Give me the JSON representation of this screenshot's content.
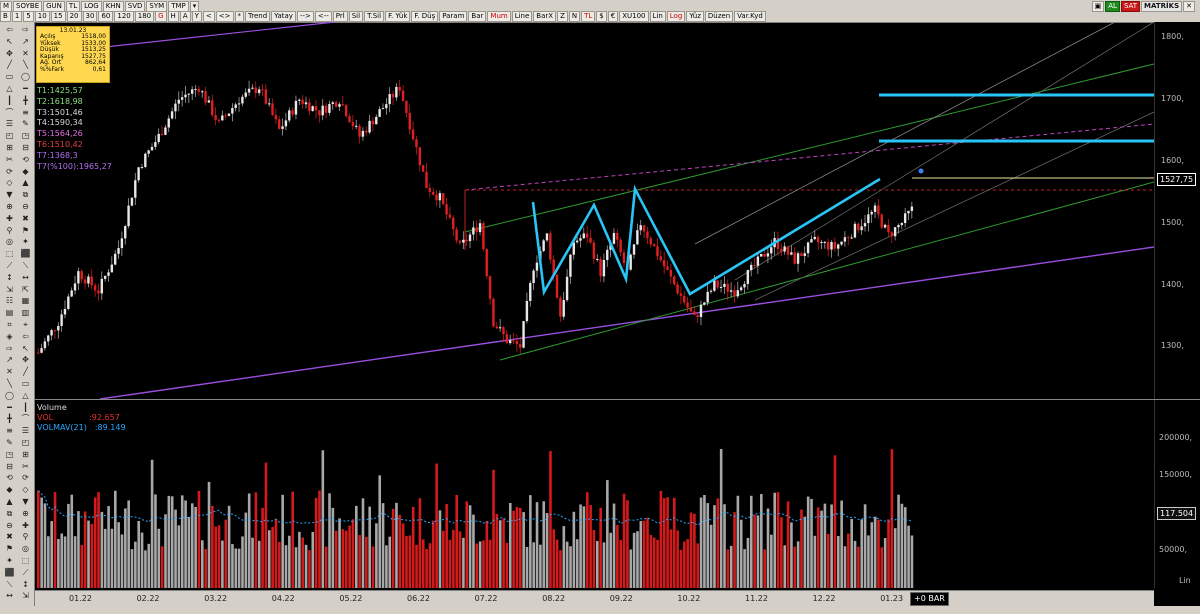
{
  "toolbar": {
    "row1": [
      {
        "t": "M",
        "c": ""
      },
      {
        "t": "SOYBE",
        "c": ""
      },
      {
        "t": "GUN",
        "c": ""
      },
      {
        "t": "TL",
        "c": ""
      },
      {
        "t": "LOG",
        "c": ""
      },
      {
        "t": "KHN",
        "c": ""
      },
      {
        "t": "SVD",
        "c": ""
      },
      {
        "t": "SYM",
        "c": ""
      },
      {
        "t": "TMP",
        "c": ""
      },
      {
        "t": "▾",
        "c": ""
      }
    ],
    "row2": [
      {
        "t": "B",
        "c": ""
      },
      {
        "t": "1",
        "c": ""
      },
      {
        "t": "5",
        "c": ""
      },
      {
        "t": "10",
        "c": ""
      },
      {
        "t": "15",
        "c": ""
      },
      {
        "t": "20",
        "c": ""
      },
      {
        "t": "30",
        "c": ""
      },
      {
        "t": "60",
        "c": ""
      },
      {
        "t": "120",
        "c": ""
      },
      {
        "t": "180",
        "c": ""
      },
      {
        "t": "G",
        "c": "red"
      },
      {
        "t": "H",
        "c": ""
      },
      {
        "t": "A",
        "c": ""
      },
      {
        "t": "Y",
        "c": ""
      },
      {
        "t": "<",
        "c": ""
      },
      {
        "t": "<>",
        "c": ""
      },
      {
        "t": "*",
        "c": ""
      },
      {
        "t": "Trend",
        "c": ""
      },
      {
        "t": "Yatay",
        "c": ""
      },
      {
        "t": "-->",
        "c": ""
      },
      {
        "t": "<--",
        "c": ""
      },
      {
        "t": "Prl",
        "c": ""
      },
      {
        "t": "Sil",
        "c": ""
      },
      {
        "t": "T.Sil",
        "c": ""
      },
      {
        "t": "F. Yük",
        "c": ""
      },
      {
        "t": "F. Düş",
        "c": ""
      },
      {
        "t": "Param",
        "c": ""
      },
      {
        "t": "Bar",
        "c": ""
      },
      {
        "t": "Mum",
        "c": "red"
      },
      {
        "t": "Line",
        "c": ""
      },
      {
        "t": "BarX",
        "c": ""
      },
      {
        "t": "Z",
        "c": ""
      },
      {
        "t": "N",
        "c": ""
      },
      {
        "t": "TL",
        "c": "red"
      },
      {
        "t": "$",
        "c": ""
      },
      {
        "t": "€",
        "c": ""
      },
      {
        "t": "XU100",
        "c": ""
      },
      {
        "t": "Lin",
        "c": ""
      },
      {
        "t": "Log",
        "c": "red"
      },
      {
        "t": "Yüz",
        "c": ""
      },
      {
        "t": "Düzen",
        "c": ""
      },
      {
        "t": "Var.Kyd",
        "c": ""
      }
    ],
    "right": {
      "al": "AL",
      "sat": "SAT",
      "brand": "MATRİKS"
    }
  },
  "info_box": {
    "date": "13.01.23",
    "rows": [
      {
        "k": "Açılış",
        "v": "1518,00"
      },
      {
        "k": "Yüksek",
        "v": "1533,00"
      },
      {
        "k": "Düşük",
        "v": "1513,25"
      },
      {
        "k": "Kapanış",
        "v": "1527,75"
      },
      {
        "k": "Ağ. Ort",
        "v": "862,64"
      },
      {
        "k": "%%Fark",
        "v": "0,61"
      }
    ]
  },
  "targets": [
    {
      "t": "T1:1425,57",
      "color": "#8ee080"
    },
    {
      "t": "T2:1618,98",
      "color": "#8ee080"
    },
    {
      "t": "T3:1501,46",
      "color": "#d8d8d8"
    },
    {
      "t": "T4:1590,34",
      "color": "#d8d8d8"
    },
    {
      "t": "T5:1564,26",
      "color": "#e070e0"
    },
    {
      "t": "T6:1510,42",
      "color": "#e04040"
    },
    {
      "t": "T7:1368,3",
      "color": "#b070f0"
    },
    {
      "t": "T7(%100):1965,27",
      "color": "#b070f0"
    }
  ],
  "volume": {
    "title": "Volume",
    "vol_label": "VOL",
    "vol_value": ":92.657",
    "mav_label": "VOLMAV(21)",
    "mav_value": ":89.149",
    "current": "117.504"
  },
  "price_axis": {
    "ticks": [
      {
        "v": 1800,
        "t": "1800,"
      },
      {
        "v": 1700,
        "t": "1700,"
      },
      {
        "v": 1600,
        "t": "1600,"
      },
      {
        "v": 1500,
        "t": "1500,"
      },
      {
        "v": 1400,
        "t": "1400,"
      },
      {
        "v": 1300,
        "t": "1300,"
      }
    ],
    "current": "1527,75"
  },
  "vol_axis": {
    "ticks": [
      {
        "v": 200000,
        "t": "200000,"
      },
      {
        "v": 150000,
        "t": "150000,"
      },
      {
        "v": 100000,
        "t": "100000,"
      },
      {
        "v": 50000,
        "t": "50000,"
      }
    ],
    "unit": "Lin"
  },
  "time_axis": [
    "01.22",
    "02.22",
    "03.22",
    "04.22",
    "05.22",
    "06.22",
    "07.22",
    "08.22",
    "09.22",
    "10.22",
    "11.22",
    "12.22",
    "01.23"
  ],
  "bar_label": "+0 BAR",
  "chart_data": {
    "type": "candlestick",
    "ylim": [
      1215,
      1825
    ],
    "vol_ylim": [
      0,
      250000
    ],
    "waypoints": [
      [
        0,
        1290
      ],
      [
        6,
        1340
      ],
      [
        12,
        1420
      ],
      [
        18,
        1390
      ],
      [
        24,
        1460
      ],
      [
        30,
        1590
      ],
      [
        36,
        1640
      ],
      [
        42,
        1700
      ],
      [
        48,
        1720
      ],
      [
        54,
        1660
      ],
      [
        60,
        1700
      ],
      [
        66,
        1720
      ],
      [
        72,
        1650
      ],
      [
        78,
        1700
      ],
      [
        84,
        1680
      ],
      [
        90,
        1700
      ],
      [
        96,
        1640
      ],
      [
        102,
        1680
      ],
      [
        108,
        1720
      ],
      [
        112,
        1640
      ],
      [
        116,
        1560
      ],
      [
        120,
        1540
      ],
      [
        126,
        1460
      ],
      [
        132,
        1500
      ],
      [
        136,
        1340
      ],
      [
        140,
        1310
      ],
      [
        144,
        1300
      ],
      [
        148,
        1430
      ],
      [
        152,
        1480
      ],
      [
        156,
        1350
      ],
      [
        160,
        1470
      ],
      [
        164,
        1480
      ],
      [
        168,
        1420
      ],
      [
        172,
        1480
      ],
      [
        176,
        1420
      ],
      [
        180,
        1500
      ],
      [
        186,
        1440
      ],
      [
        190,
        1400
      ],
      [
        196,
        1345
      ],
      [
        202,
        1400
      ],
      [
        208,
        1390
      ],
      [
        214,
        1430
      ],
      [
        220,
        1470
      ],
      [
        226,
        1440
      ],
      [
        232,
        1470
      ],
      [
        238,
        1460
      ],
      [
        244,
        1490
      ],
      [
        250,
        1520
      ],
      [
        254,
        1480
      ],
      [
        258,
        1500
      ],
      [
        262,
        1528
      ]
    ]
  }
}
